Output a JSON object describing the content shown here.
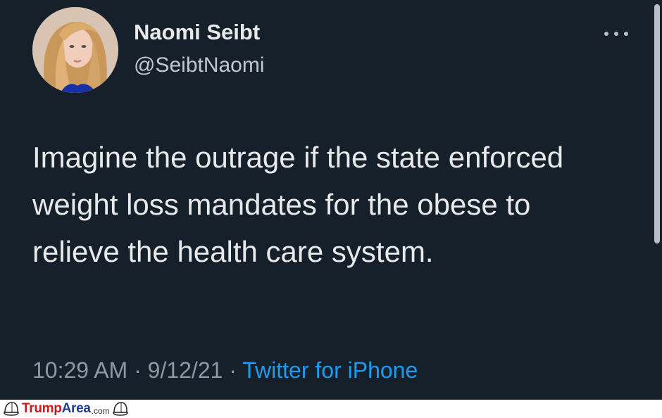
{
  "tweet": {
    "author": {
      "display_name": "Naomi Seibt",
      "handle": "@SeibtNaomi",
      "avatar_icon": "profile-photo-avatar"
    },
    "text": "Imagine the outrage if the state enforced weight loss mandates for the obese to relieve the health care system.",
    "meta": {
      "time": "10:29 AM",
      "separator": "·",
      "date": "9/12/21",
      "source": "Twitter for iPhone"
    },
    "more_icon": "more-horizontal-icon"
  },
  "watermark": {
    "brand_part1": "Trump",
    "brand_part2": "Area",
    "domain_suffix": ".com",
    "icon": "maga-hat-icon"
  },
  "colors": {
    "background": "#15202b",
    "text_primary": "#e7e9ea",
    "text_secondary": "#8b98a5",
    "link": "#1d9bf0",
    "watermark_red": "#c8191e",
    "watermark_blue": "#1f3d8f"
  }
}
